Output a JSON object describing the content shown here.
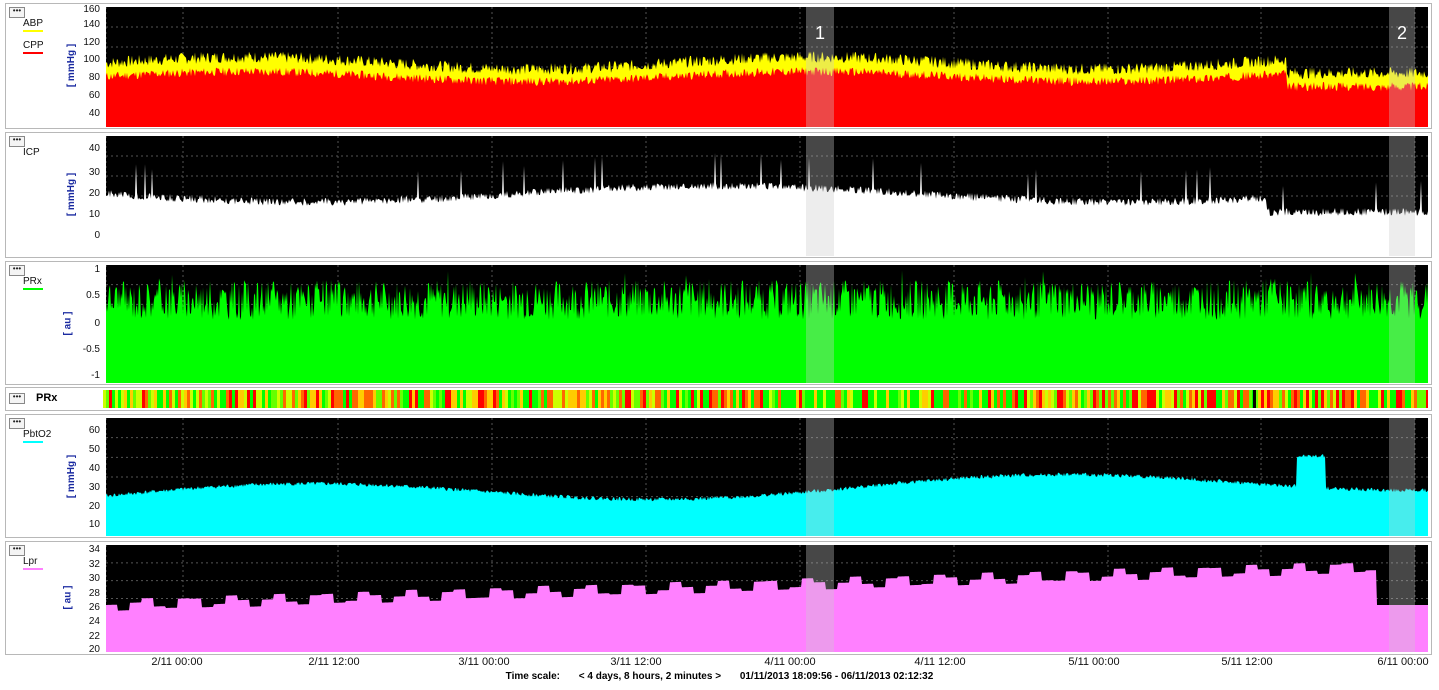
{
  "panels": {
    "abp_cpp": {
      "legend": [
        "ABP",
        "CPP"
      ],
      "legend_colors": [
        "#ffff00",
        "#ff0000"
      ],
      "unit": "[ mmHg ]",
      "ticks": [
        "160",
        "140",
        "120",
        "100",
        "80",
        "60",
        "40"
      ]
    },
    "icp": {
      "legend": [
        "ICP"
      ],
      "legend_colors": [
        "#000000"
      ],
      "unit": "[ mmHg ]",
      "ticks": [
        "40",
        "30",
        "20",
        "10",
        "0"
      ]
    },
    "prx": {
      "legend": [
        "PRx"
      ],
      "legend_colors": [
        "#00ff00"
      ],
      "unit": "[ au ]",
      "ticks": [
        "1",
        "0.5",
        "0",
        "-0.5",
        "-1"
      ]
    },
    "prx_bar": {
      "label": "PRx"
    },
    "pbto2": {
      "legend": [
        "PbtO2"
      ],
      "legend_colors": [
        "#00ffff"
      ],
      "unit": "[ mmHg ]",
      "ticks": [
        "60",
        "50",
        "40",
        "30",
        "20",
        "10"
      ]
    },
    "lpr": {
      "legend": [
        "Lpr"
      ],
      "legend_colors": [
        "#ff80ff"
      ],
      "unit": "[ au ]",
      "ticks": [
        "34",
        "32",
        "30",
        "28",
        "26",
        "24",
        "22",
        "20"
      ]
    }
  },
  "markers": [
    "1",
    "2"
  ],
  "x_axis": [
    "2/11 00:00",
    "2/11 12:00",
    "3/11 00:00",
    "3/11 12:00",
    "4/11 00:00",
    "4/11 12:00",
    "5/11 00:00",
    "5/11 12:00",
    "6/11 00:00"
  ],
  "footer": {
    "label": "Time scale:",
    "span": "< 4 days, 8 hours, 2 minutes >",
    "range": "01/11/2013 18:09:56 - 06/11/2013 02:12:32"
  },
  "colors": {
    "abp": "#ffff00",
    "cpp": "#ff0000",
    "icp": "#ffffff",
    "prx": "#00ff00",
    "pbto2": "#00ffff",
    "lpr": "#ff80ff",
    "plot_bg": "#000000",
    "highlight": "#cccccc"
  }
}
